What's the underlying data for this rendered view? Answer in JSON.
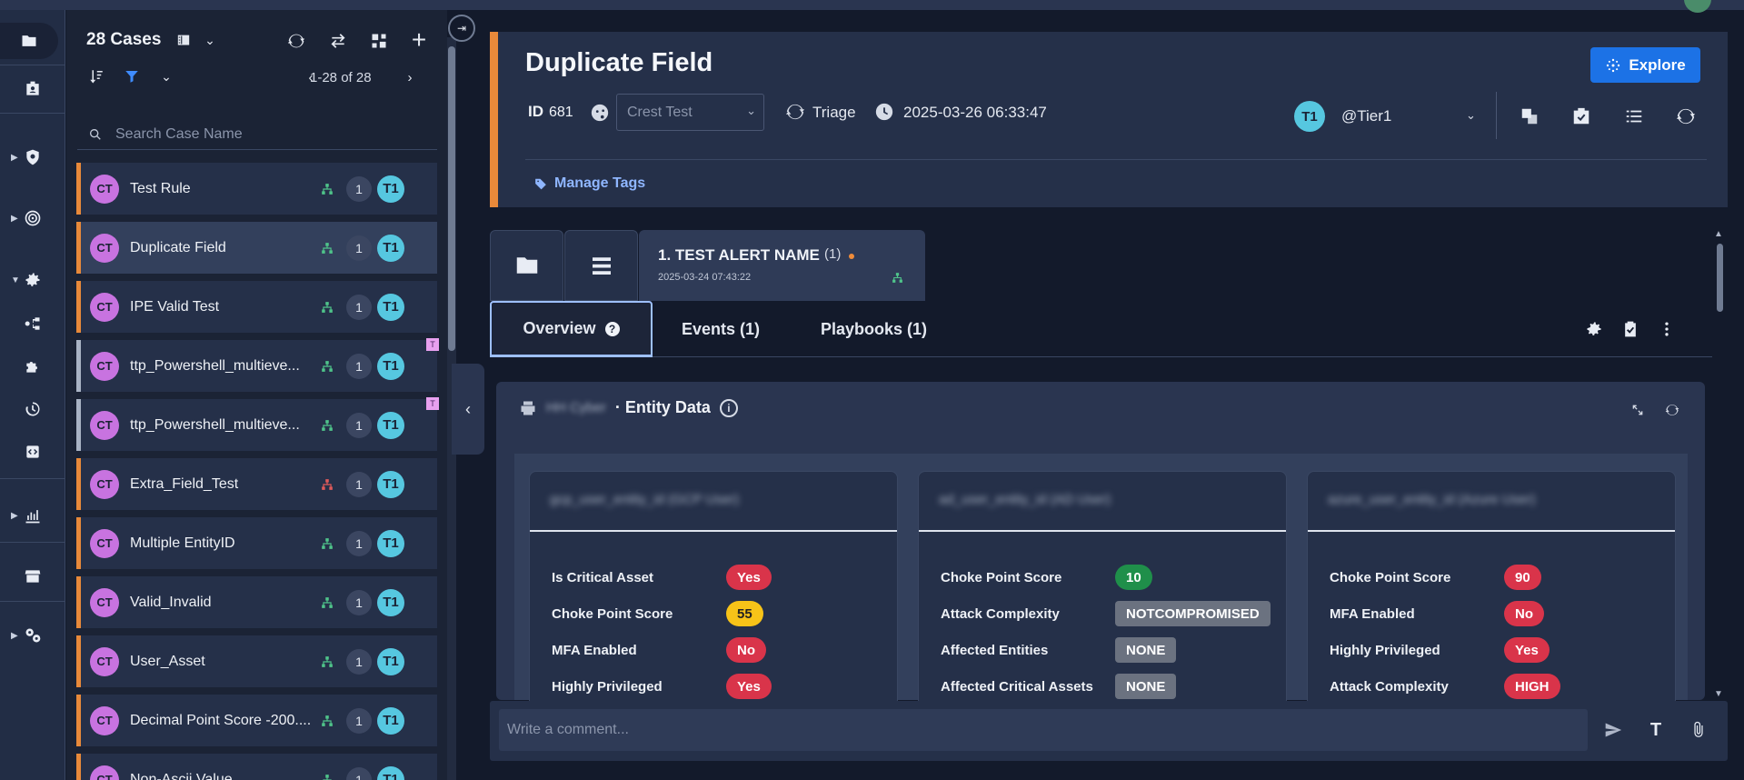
{
  "rail": {
    "items": [
      {
        "icon": "folder-icon"
      },
      {
        "icon": "id-badge-icon"
      },
      {
        "icon": "shield-search-icon"
      },
      {
        "icon": "radar-icon"
      },
      {
        "icon": "gear-icon"
      },
      {
        "icon": "flow-icon"
      },
      {
        "icon": "puzzle-icon"
      },
      {
        "icon": "history-icon"
      },
      {
        "icon": "code-icon"
      },
      {
        "icon": "chart-icon"
      },
      {
        "icon": "store-icon"
      },
      {
        "icon": "settings-cog-icon"
      }
    ]
  },
  "cases": {
    "title": "28 Cases",
    "pager": "1-28 of 28",
    "search_placeholder": "Search Case Name",
    "list": [
      {
        "avatar": "CT",
        "name": "Test Rule",
        "count": "1",
        "tier": "T1"
      },
      {
        "avatar": "CT",
        "name": "Duplicate Field",
        "count": "1",
        "tier": "T1"
      },
      {
        "avatar": "CT",
        "name": "IPE Valid Test",
        "count": "1",
        "tier": "T1"
      },
      {
        "avatar": "CT",
        "name": "ttp_Powershell_multieve...",
        "count": "1",
        "tier": "T1",
        "flag": "T"
      },
      {
        "avatar": "CT",
        "name": "ttp_Powershell_multieve...",
        "count": "1",
        "tier": "T1",
        "flag": "T"
      },
      {
        "avatar": "CT",
        "name": "Extra_Field_Test",
        "count": "1",
        "tier": "T1"
      },
      {
        "avatar": "CT",
        "name": "Multiple EntityID",
        "count": "1",
        "tier": "T1"
      },
      {
        "avatar": "CT",
        "name": "Valid_Invalid",
        "count": "1",
        "tier": "T1"
      },
      {
        "avatar": "CT",
        "name": "User_Asset",
        "count": "1",
        "tier": "T1"
      },
      {
        "avatar": "CT",
        "name": "Decimal Point Score -200....",
        "count": "1",
        "tier": "T1"
      },
      {
        "avatar": "CT",
        "name": "Non-Ascii Value",
        "count": "1",
        "tier": "T1"
      }
    ]
  },
  "header": {
    "title": "Duplicate Field",
    "explore_label": "Explore",
    "id_label": "ID",
    "id_value": "681",
    "source_placeholder": "Crest Test",
    "stage": "Triage",
    "timestamp": "2025-03-26 06:33:47",
    "owner_avatar": "T1",
    "owner_name": "@Tier1",
    "manage_tags": "Manage Tags"
  },
  "alert": {
    "name": "1. TEST ALERT NAME",
    "count": "(1)",
    "date": "2025-03-24 07:43:22"
  },
  "tabs": {
    "overview": "Overview",
    "events": "Events (1)",
    "playbooks": "Playbooks (1)"
  },
  "entity": {
    "vendor_blurred": "HH Cyber",
    "title": "· Entity Data",
    "cards": [
      {
        "title_blurred": "gcp_user_entity_id (GCP User)",
        "rows": [
          {
            "label": "Is Critical Asset",
            "value": "Yes",
            "color": "red"
          },
          {
            "label": "Choke Point Score",
            "value": "55",
            "color": "yellow"
          },
          {
            "label": "MFA Enabled",
            "value": "No",
            "color": "red"
          },
          {
            "label": "Highly Privileged",
            "value": "Yes",
            "color": "red"
          }
        ]
      },
      {
        "title_blurred": "ad_user_entity_id (AD User)",
        "rows": [
          {
            "label": "Choke Point Score",
            "value": "10",
            "color": "green"
          },
          {
            "label": "Attack Complexity",
            "value": "NOTCOMPROMISED",
            "color": "gray"
          },
          {
            "label": "Affected Entities",
            "value": "NONE",
            "color": "gray"
          },
          {
            "label": "Affected Critical Assets",
            "value": "NONE",
            "color": "gray"
          }
        ]
      },
      {
        "title_blurred": "azure_user_entity_id (Azure User)",
        "rows": [
          {
            "label": "Choke Point Score",
            "value": "90",
            "color": "red"
          },
          {
            "label": "MFA Enabled",
            "value": "No",
            "color": "red"
          },
          {
            "label": "Highly Privileged",
            "value": "Yes",
            "color": "red"
          },
          {
            "label": "Attack Complexity",
            "value": "HIGH",
            "color": "red"
          }
        ]
      }
    ]
  },
  "comment": {
    "placeholder": "Write a comment...",
    "format_label": "T"
  },
  "colors": {
    "accent_orange": "#e8893a",
    "primary_blue": "#1c72e6",
    "avatar_purple": "#c873e0",
    "tier_cyan": "#56c7e0"
  }
}
